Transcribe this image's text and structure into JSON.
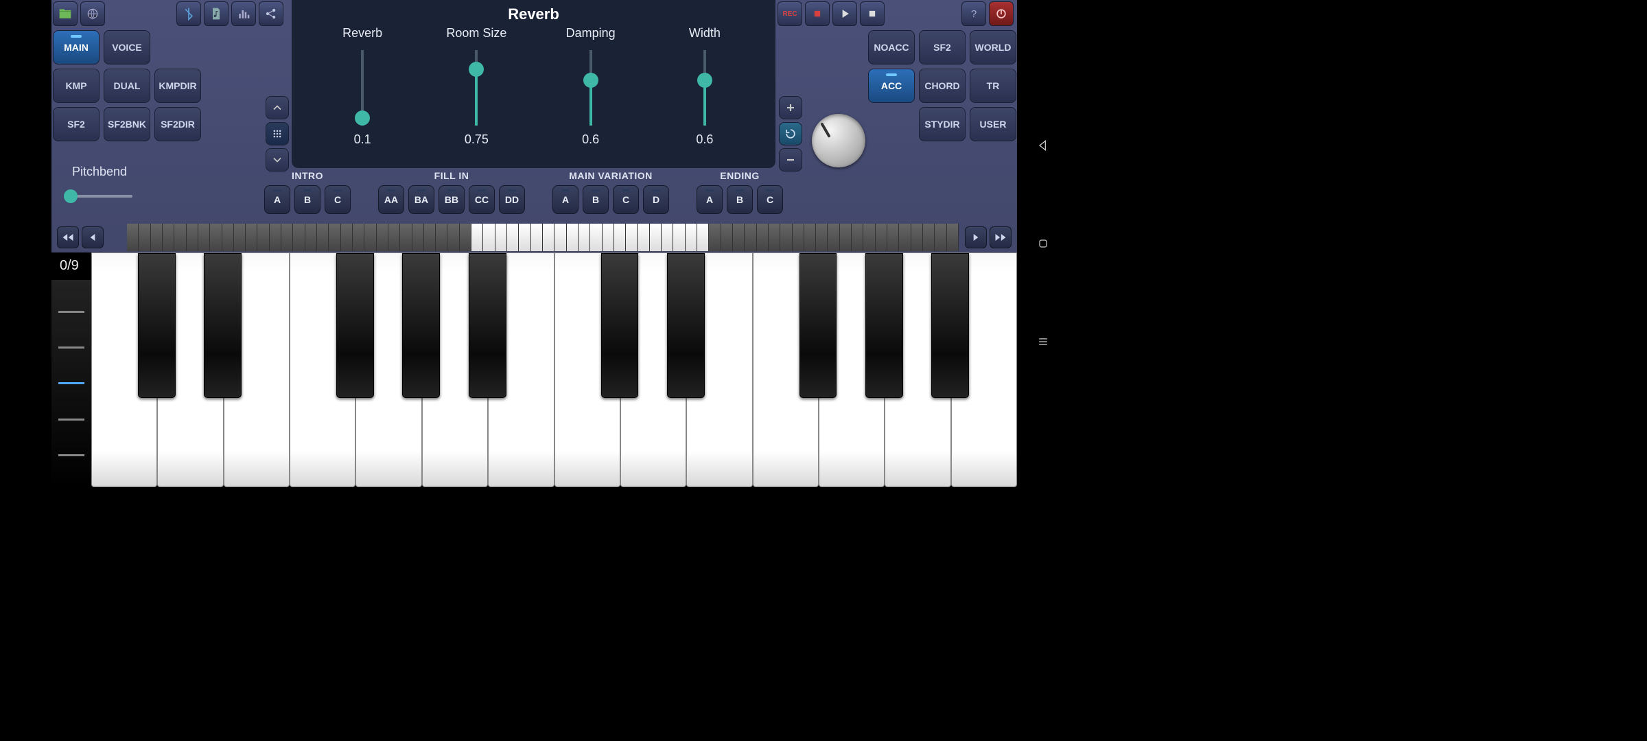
{
  "title": "Reverb",
  "top_icons_left": [
    "folder-icon",
    "globe-icon"
  ],
  "top_icons_mid": [
    "bluetooth-icon",
    "music-icon",
    "equalizer-icon",
    "share-icon"
  ],
  "top_icons_right": [
    "help-icon",
    "power-icon"
  ],
  "transport": [
    "rec-button",
    "stop-button",
    "play-button",
    "square-button"
  ],
  "tabs_left": [
    {
      "id": "main",
      "label": "MAIN",
      "active": true
    },
    {
      "id": "voice",
      "label": "VOICE"
    },
    {
      "id": "kmp",
      "label": "KMP"
    },
    {
      "id": "dual",
      "label": "DUAL"
    },
    {
      "id": "kmpdir",
      "label": "KMPDIR"
    },
    {
      "id": "sf2",
      "label": "SF2"
    },
    {
      "id": "sf2bnk",
      "label": "SF2BNK"
    },
    {
      "id": "sf2dir",
      "label": "SF2DIR"
    }
  ],
  "tabs_right": [
    {
      "id": "noacc",
      "label": "NOACC"
    },
    {
      "id": "sf2r",
      "label": "SF2"
    },
    {
      "id": "world",
      "label": "WORLD"
    },
    {
      "id": "acc",
      "label": "ACC",
      "active": true
    },
    {
      "id": "chord",
      "label": "CHORD"
    },
    {
      "id": "tr",
      "label": "TR"
    },
    {
      "id": "stydir",
      "label": "STYDIR"
    },
    {
      "id": "user",
      "label": "USER"
    }
  ],
  "sliders": [
    {
      "label": "Reverb",
      "value": "0.1",
      "pct": 10
    },
    {
      "label": "Room Size",
      "value": "0.75",
      "pct": 75
    },
    {
      "label": "Damping",
      "value": "0.6",
      "pct": 60
    },
    {
      "label": "Width",
      "value": "0.6",
      "pct": 60
    }
  ],
  "pitchbend_label": "Pitchbend",
  "sections": [
    {
      "title": "INTRO",
      "btns": [
        "A",
        "B",
        "C"
      ]
    },
    {
      "title": "FILL IN",
      "btns": [
        "AA",
        "BA",
        "BB",
        "CC",
        "DD"
      ]
    },
    {
      "title": "MAIN VARIATION",
      "btns": [
        "A",
        "B",
        "C",
        "D"
      ]
    },
    {
      "title": "ENDING",
      "btns": [
        "A",
        "B",
        "C"
      ]
    }
  ],
  "octave_label": "0/9",
  "colors": {
    "accent": "#3fb8a8",
    "active": "#2d6fb8",
    "rec": "#d84040"
  }
}
